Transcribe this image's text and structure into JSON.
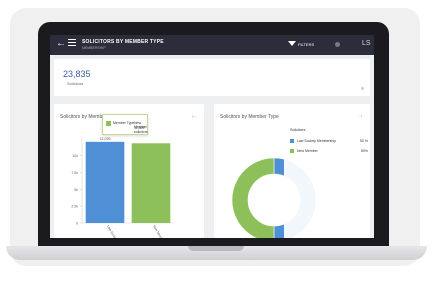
{
  "header": {
    "title": "SOLICITORS BY MEMBER TYPE",
    "subtitle": "MEMBERSHIP",
    "filter_label": "FILTERS",
    "right_text": "LS"
  },
  "kpi": {
    "value": "23,835",
    "label": "Solicitors"
  },
  "colors": {
    "header_bg": "#2b2d3a",
    "bar_blue": "#4f8fd6",
    "bar_green": "#8dc05a",
    "accent": "#3b5fa0"
  },
  "icons": [
    "back-arrow-icon",
    "menu-icon",
    "filter-icon",
    "more-icon",
    "panel-menu-icon"
  ],
  "chart_panels": [
    {
      "title": "Solicitors by Member Type"
    },
    {
      "title": "Solicitors by Member Type"
    }
  ],
  "tooltip": {
    "category_label": "Member Type",
    "category_value": "New Member",
    "value": "11,809",
    "value_label": "solicitors"
  },
  "legend_popup": {
    "header": "Solicitors",
    "items": [
      {
        "name": "Law Society Membership",
        "percent": "50 %"
      },
      {
        "name": "New Member",
        "percent": "50%"
      }
    ]
  },
  "chart_data": [
    {
      "type": "bar",
      "title": "Solicitors by Member Type",
      "categories": [
        "Law Society Membership",
        "New Member"
      ],
      "values": [
        12026,
        11809
      ],
      "yticks": [
        "0",
        "2.5k",
        "5k",
        "7.5k",
        "10k"
      ],
      "ylim": [
        0,
        12000
      ],
      "value_labels": [
        "12,026",
        ""
      ],
      "bar_colors": [
        "#4f8fd6",
        "#8dc05a"
      ]
    },
    {
      "type": "pie",
      "title": "Solicitors by Member Type",
      "labels": [
        "Law Society Membership",
        "New Member"
      ],
      "values": [
        50,
        50
      ],
      "colors": [
        "#4f8fd6",
        "#8dc05a"
      ]
    }
  ]
}
